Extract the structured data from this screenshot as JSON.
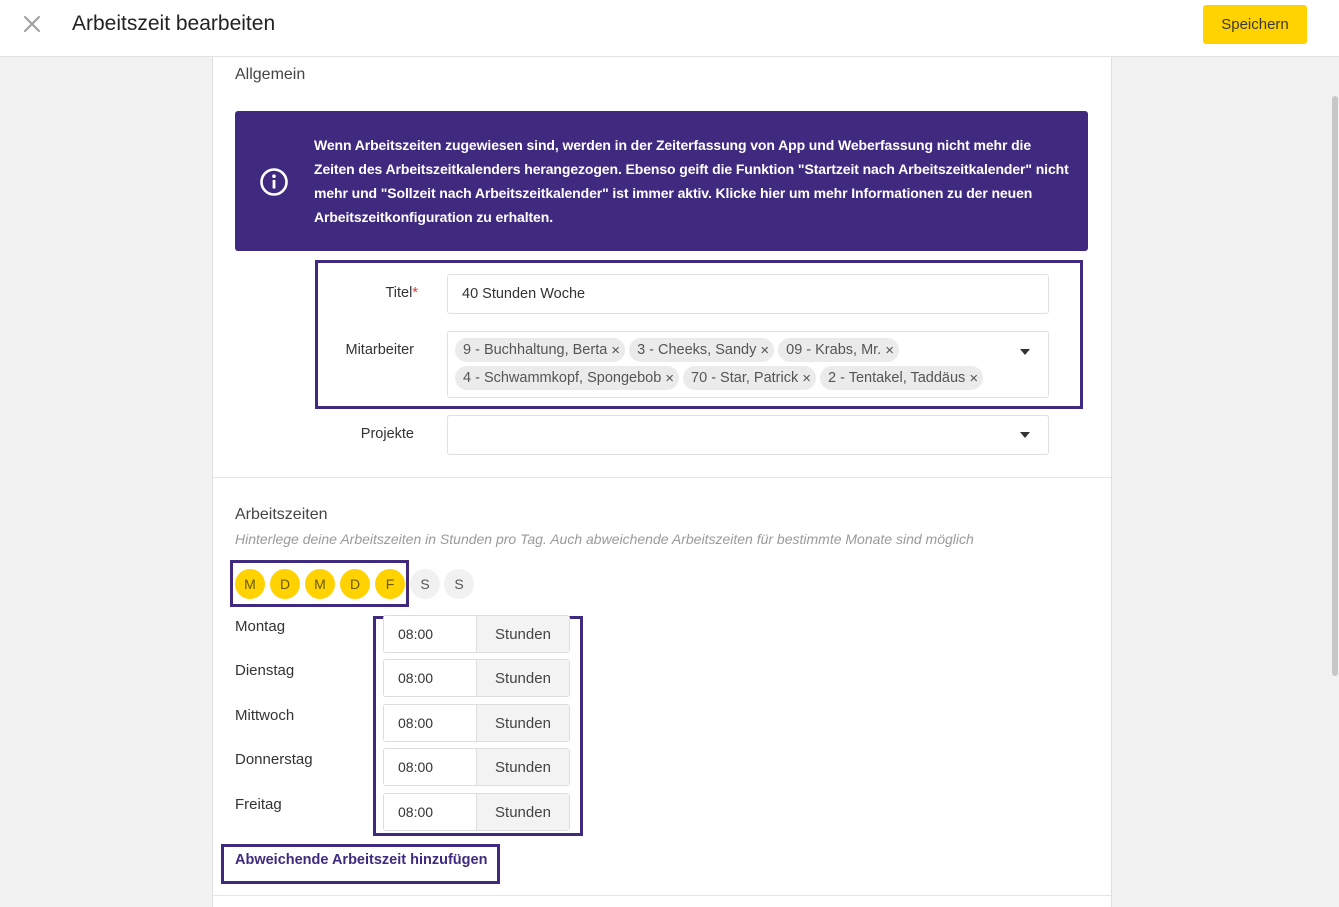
{
  "header": {
    "title": "Arbeitszeit bearbeiten",
    "save_label": "Speichern",
    "close_icon": "close-icon"
  },
  "general": {
    "section_title": "Allgemein",
    "info_text": "Wenn Arbeitszeiten zugewiesen sind, werden in der Zeiterfassung von App und Weberfassung nicht mehr die Zeiten des Arbeitszeitkalenders herangezogen. Ebenso geift die Funktion \"Startzeit nach Arbeitszeitkalender\" nicht mehr und \"Sollzeit nach Arbeitszeitkalender\" ist immer aktiv. Klicke hier um mehr Informationen zu der neuen Arbeitszeitkonfiguration zu erhalten.",
    "info_icon": "info-icon",
    "info_bg": "#3f2a80",
    "title_label": "Titel",
    "required_mark": "*",
    "title_value": "40 Stunden Woche",
    "employees_label": "Mitarbeiter",
    "employees": [
      "9 - Buchhaltung, Berta",
      "3 - Cheeks, Sandy",
      "09 - Krabs, Mr.",
      "4 - Schwammkopf, Spongebob",
      "70 - Star, Patrick",
      "2 - Tentakel, Taddäus"
    ],
    "projects_label": "Projekte",
    "projects_value": ""
  },
  "worktimes": {
    "section_title": "Arbeitszeiten",
    "subtitle": "Hinterlege deine Arbeitszeiten in Stunden pro Tag. Auch abweichende Arbeitszeiten für bestimmte Monate sind möglich",
    "weekdays": [
      {
        "letter": "M",
        "active": true
      },
      {
        "letter": "D",
        "active": true
      },
      {
        "letter": "M",
        "active": true
      },
      {
        "letter": "D",
        "active": true
      },
      {
        "letter": "F",
        "active": true
      },
      {
        "letter": "S",
        "active": false
      },
      {
        "letter": "S",
        "active": false
      }
    ],
    "active_color": "#ffd200",
    "days": [
      {
        "label": "Montag",
        "value": "08:00",
        "unit": "Stunden"
      },
      {
        "label": "Dienstag",
        "value": "08:00",
        "unit": "Stunden"
      },
      {
        "label": "Mittwoch",
        "value": "08:00",
        "unit": "Stunden"
      },
      {
        "label": "Donnerstag",
        "value": "08:00",
        "unit": "Stunden"
      },
      {
        "label": "Freitag",
        "value": "08:00",
        "unit": "Stunden"
      }
    ],
    "add_label": "Abweichende Arbeitszeit hinzufügen"
  }
}
